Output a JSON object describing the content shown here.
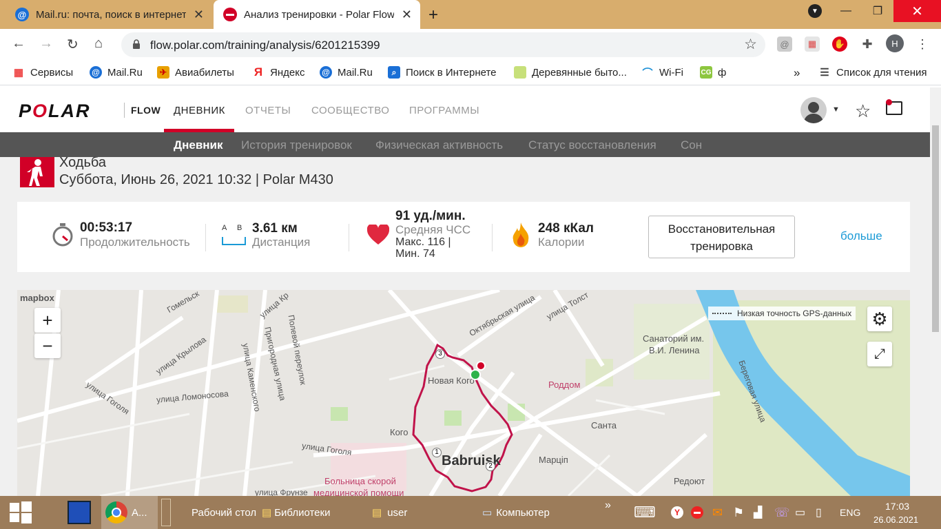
{
  "browser": {
    "tabs": [
      {
        "title": "Mail.ru: почта, поиск в интернете"
      },
      {
        "title": "Анализ тренировки - Polar Flow"
      }
    ],
    "url": "flow.polar.com/training/analysis/6201215399",
    "profile_initial": "Н",
    "bookmarks": [
      "Сервисы",
      "Mail.Ru",
      "Авиабилеты",
      "Яндекс",
      "Mail.Ru",
      "Поиск в Интернете",
      "Деревянные быто...",
      "Wi-Fi",
      "ф"
    ],
    "reading_list": "Список для чтения",
    "bookmarks_more": "»"
  },
  "polar": {
    "logo": {
      "a": "P",
      "o": "O",
      "b": "LAR"
    },
    "flow": "FLOW",
    "nav": [
      "ДНЕВНИК",
      "ОТЧЕТЫ",
      "СООБЩЕСТВО",
      "ПРОГРАММЫ"
    ],
    "subnav": [
      "Дневник",
      "История тренировок",
      "Физическая активность",
      "Статус восстановления",
      "Сон"
    ]
  },
  "session": {
    "sport": "Ходьба",
    "date_device": "Суббота, Июнь 26, 2021 10:32 | Polar M430"
  },
  "stats": {
    "duration_value": "00:53:17",
    "duration_label": "Продолжительность",
    "distance_ab": "A     B",
    "distance_value": "3.61 км",
    "distance_label": "Дистанция",
    "hr_value": "91 уд./мин.",
    "hr_label": "Средняя ЧСС",
    "hr_max": "Макс. 116  |",
    "hr_min": "Мин. 74",
    "calories_value": "248 кКал",
    "calories_label": "Калории",
    "recovery_button": "Восстановительная тренировка",
    "more": "больше"
  },
  "map": {
    "attribution": "mapbox",
    "zoom_in": "+",
    "zoom_out": "−",
    "gps_legend": "Низкая точность GPS-данных",
    "streets": [
      "Гомельск",
      "улица Кр",
      "улица Крылова",
      "Полевой переулок",
      "Пригородная улица",
      "улица Каменского",
      "улица Ломоносова",
      "улица Гоголя",
      "улица Гоголя",
      "улица Фрунзе",
      "Октябрьская улица",
      "улица Толст",
      "Береговая улица"
    ],
    "places": [
      "Санаторий им.",
      "В.И. Ленина",
      "Роддом",
      "Санта",
      "Марціп",
      "Редоют",
      "Кого",
      "Новая Кого",
      "Больница скорой",
      "медицинской помощи"
    ],
    "city": "Babruisk",
    "markers": [
      "1",
      "2",
      "3"
    ]
  },
  "taskbar": {
    "app_label": "А...",
    "items": [
      "Рабочий стол",
      "Библиотеки",
      "user",
      "Компьютер"
    ],
    "overflow": "»",
    "lang": "ENG",
    "time": "17:03",
    "date": "26.06.2021"
  }
}
